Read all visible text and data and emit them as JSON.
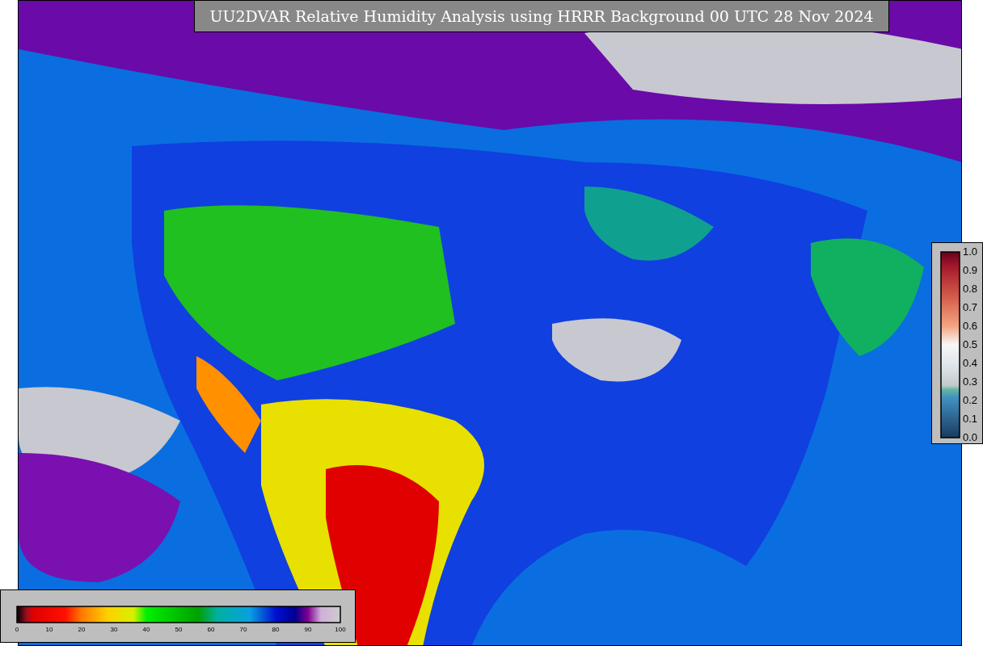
{
  "title": "UU2DVAR Relative Humidity Analysis using HRRR Background 00 UTC 28 Nov 2024",
  "humidity_legend": {
    "ticks": [
      "0",
      "10",
      "20",
      "30",
      "40",
      "50",
      "60",
      "70",
      "80",
      "90",
      "100"
    ]
  },
  "ratio_legend": {
    "ticks": [
      "1.0",
      "0.9",
      "0.8",
      "0.7",
      "0.6",
      "0.5",
      "0.4",
      "0.3",
      "0.2",
      "0.1",
      "0.0"
    ]
  }
}
